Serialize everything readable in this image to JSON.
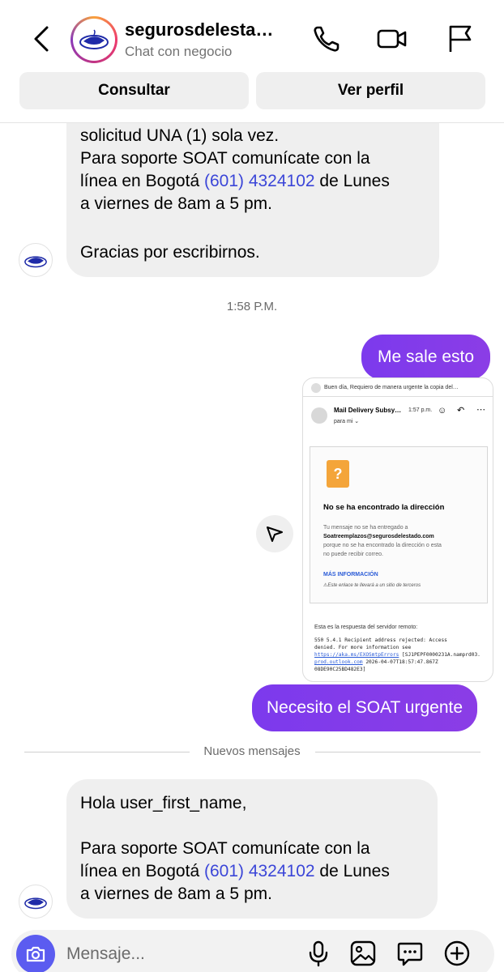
{
  "header": {
    "name": "segurosdelesta…",
    "subtitle": "Chat con negocio",
    "btn_consultar": "Consultar",
    "btn_perfil": "Ver perfil"
  },
  "messages": {
    "first": {
      "line1": "solicitud UNA (1) sola vez.",
      "line2": "Para soporte SOAT comunícate con la",
      "line3_pre": "línea en Bogotá ",
      "phone": "(601) 4324102",
      "line3_post": " de Lunes",
      "line4": "a viernes de 8am a 5 pm.",
      "line5": "Gracias por escribirnos."
    },
    "timestamp": "1:58 P.M.",
    "out1": "Me sale esto",
    "out2": "Necesito el SOAT urgente",
    "divider": "Nuevos mensajes",
    "last": {
      "line1": "Hola user_first_name,",
      "line2": "Para soporte SOAT comunícate con la",
      "line3_pre": "línea en Bogotá ",
      "phone": "(601) 4324102",
      "line3_post": " de Lunes",
      "line4": "a viernes de 8am a 5 pm."
    }
  },
  "screenshot": {
    "top_line": "Buen día, Requiero de manera urgente la copia del…",
    "sender": "Mail Delivery Subsy…",
    "time": "1:57 p.m.",
    "to": "para mi ⌄",
    "heading": "No se ha encontrado la dirección",
    "body1": "Tu mensaje no se ha entregado a",
    "email": "Soatreemplazos@segurosdelestado.com",
    "body2": "porque no se ha encontrado la dirección o esta",
    "body3": "no puede recibir correo.",
    "more": "MÁS INFORMACIÓN",
    "warning": "⚠Este enlace te llevará a un sitio de terceros",
    "server_label": "Esta es la respuesta del servidor remoto:",
    "server1": "550 5.4.1 Recipient address rejected: Access",
    "server2": "denied. For more information see",
    "server3a": "https://aka.ms/EXOSmtpErrors",
    "server3b": " [SJ1PEPF0000231A.namprd03.",
    "server4a": "prod.outlook.com",
    "server4b": " 2026-04-07T18:57:47.867Z",
    "server5": "08DE90C25BD482E3]"
  },
  "composer": {
    "placeholder": "Mensaje..."
  },
  "colors": {
    "outgoing_bubble": "#7c3aed",
    "incoming_bubble": "#efefef",
    "link": "#3b46d8",
    "camera_button": "#5b5cf0"
  }
}
